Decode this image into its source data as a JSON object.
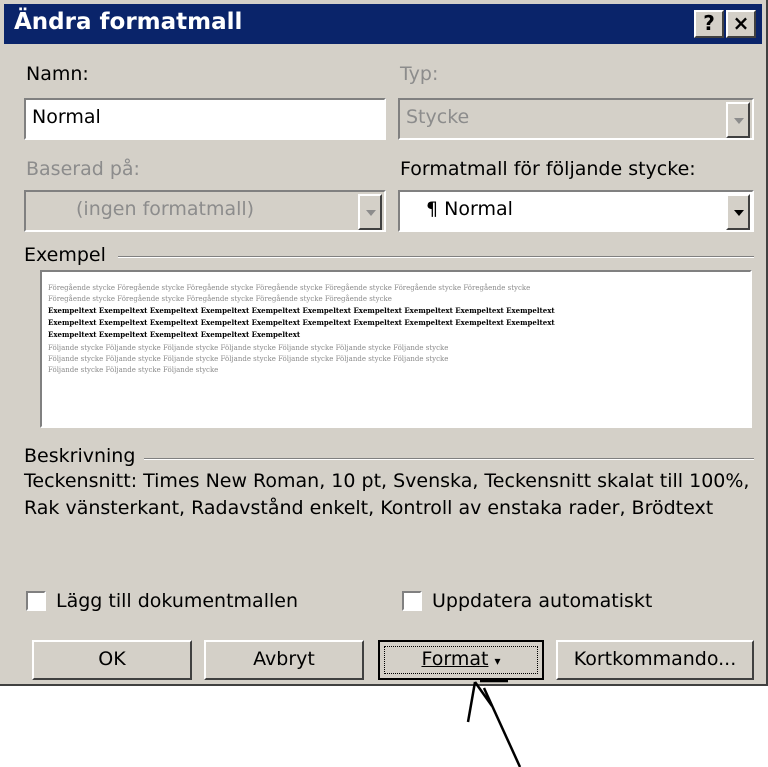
{
  "dialog": {
    "title": "Ändra formatmall",
    "help_glyph": "?",
    "close_glyph": "×"
  },
  "name": {
    "label": "Namn:",
    "value": "Normal"
  },
  "type": {
    "label": "Typ:",
    "value": "Stycke"
  },
  "based_on": {
    "label": "Baserad på:",
    "value": "(ingen formatmall)"
  },
  "next_style": {
    "label": "Formatmall för följande stycke:",
    "value": "Normal",
    "icon_glyph": "¶"
  },
  "preview": {
    "label": "Exempel",
    "prev_lines": [
      "Föregående stycke Föregående stycke Föregående stycke Föregående stycke Föregående stycke Föregående stycke Föregående stycke",
      "Föregående stycke Föregående stycke Föregående stycke Föregående stycke Föregående stycke"
    ],
    "sample_lines": [
      "Exempeltext Exempeltext Exempeltext Exempeltext Exempeltext Exempeltext Exempeltext Exempeltext Exempeltext Exempeltext",
      "Exempeltext Exempeltext Exempeltext Exempeltext Exempeltext Exempeltext Exempeltext Exempeltext Exempeltext Exempeltext",
      "Exempeltext Exempeltext Exempeltext Exempeltext Exempeltext"
    ],
    "next_lines": [
      "Följande stycke Följande stycke Följande stycke Följande stycke Följande stycke Följande stycke Följande stycke",
      "Följande stycke Följande stycke Följande stycke Följande stycke Följande stycke Följande stycke Följande stycke",
      "Följande stycke Följande stycke Följande stycke"
    ]
  },
  "description": {
    "label": "Beskrivning",
    "text": "Teckensnitt: Times New Roman, 10 pt, Svenska, Teckensnitt skalat till 100%, Rak vänsterkant, Radavstånd enkelt, Kontroll av enstaka rader, Brödtext"
  },
  "checkboxes": {
    "add_to_template": {
      "label": "Lägg till dokumentmallen",
      "checked": false
    },
    "auto_update": {
      "label": "Uppdatera automatiskt",
      "checked": false
    }
  },
  "buttons": {
    "ok": "OK",
    "cancel": "Avbryt",
    "format": "Format",
    "format_arrow": "▾",
    "shortcut": "Kortkommando..."
  },
  "colors": {
    "titlebar": "#0a246a",
    "face": "#d4d0c8",
    "disabled_text": "#8c8c8c"
  },
  "annotation": {
    "icon": "arrow-pointer-icon"
  }
}
